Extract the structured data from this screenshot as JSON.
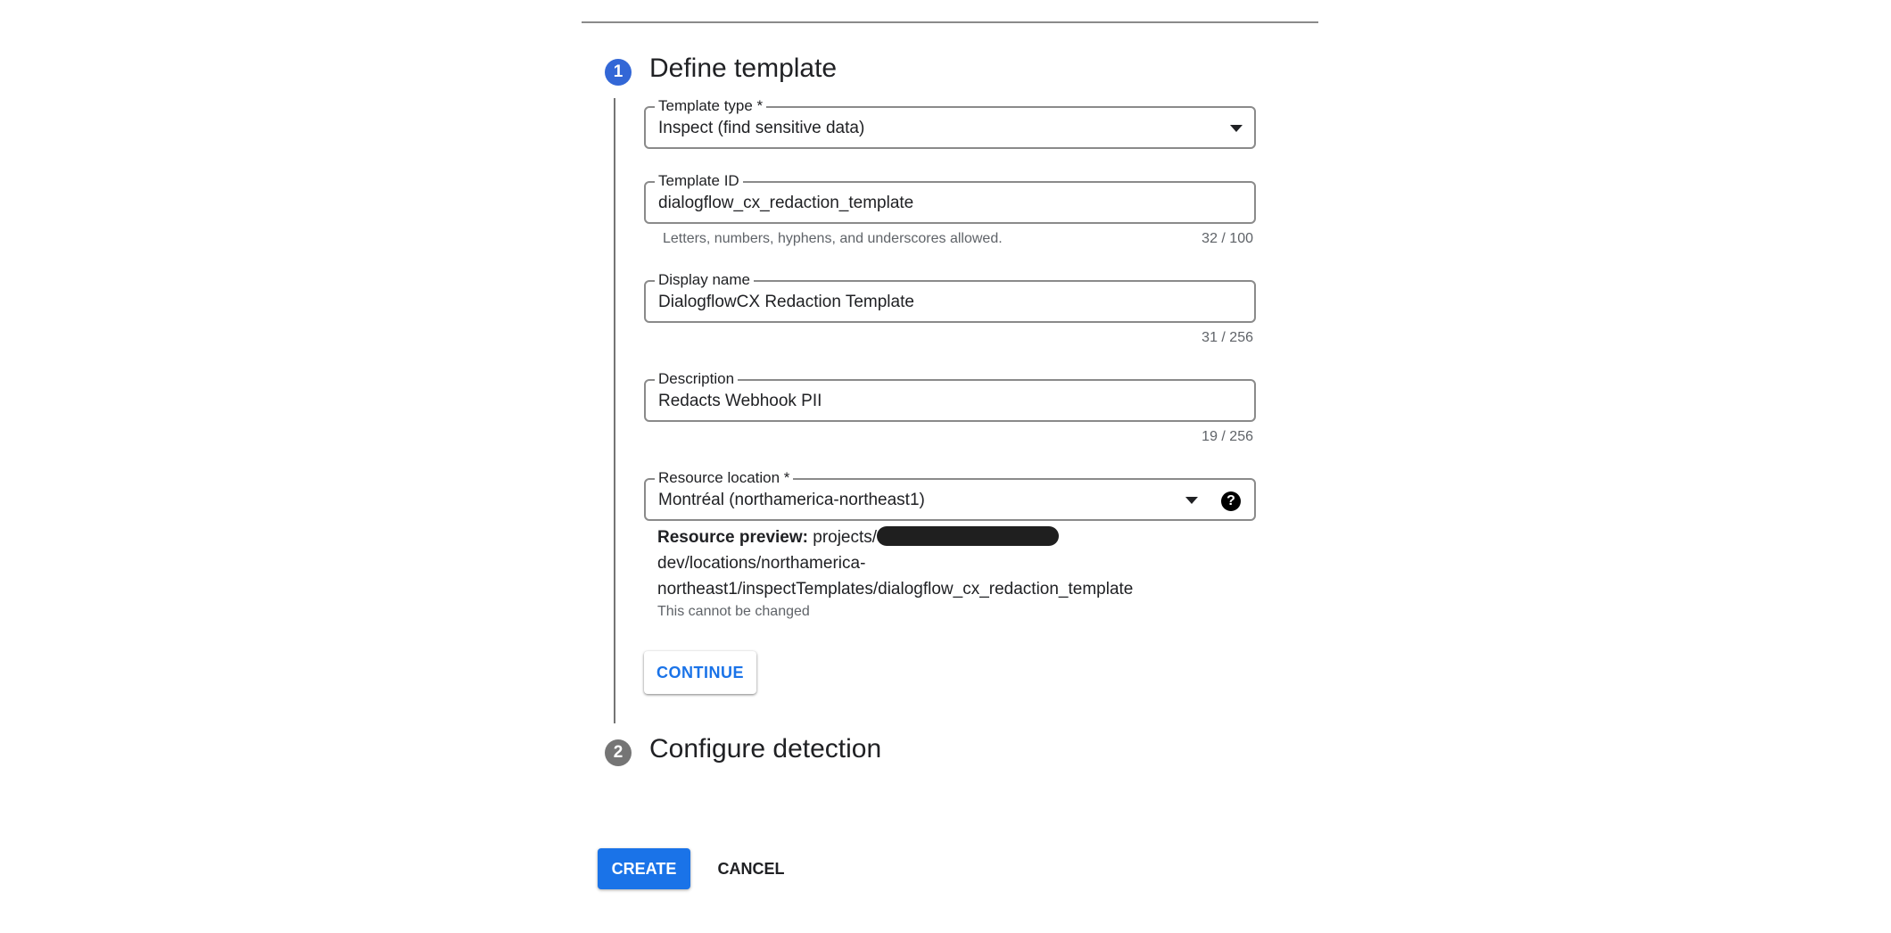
{
  "steps": [
    {
      "number": "1",
      "title": "Define template",
      "active": true
    },
    {
      "number": "2",
      "title": "Configure detection",
      "active": false
    }
  ],
  "colors": {
    "active_step": "#3367d6",
    "inactive_step": "#757575",
    "primary": "#1a73e8"
  },
  "form": {
    "template_type": {
      "label": "Template type *",
      "value": "Inspect (find sensitive data)",
      "icon": "chevron-down-icon"
    },
    "template_id": {
      "label": "Template ID",
      "value": "dialogflow_cx_redaction_template",
      "hint": "Letters, numbers, hyphens, and underscores allowed.",
      "counter": "32 / 100"
    },
    "display_name": {
      "label": "Display name",
      "value": "DialogflowCX Redaction Template",
      "counter": "31 / 256"
    },
    "description": {
      "label": "Description",
      "value": "Redacts Webhook PII",
      "counter": "19 / 256"
    },
    "resource_location": {
      "label": "Resource location *",
      "value": "Montréal (northamerica-northeast1)",
      "icon": "chevron-down-icon",
      "help_icon": "help-icon",
      "help_glyph": "?"
    }
  },
  "resource_preview": {
    "label": "Resource preview:",
    "line1": "projects/",
    "line2": "dev/locations/northamerica-",
    "line3": "northeast1/inspectTemplates/dialogflow_cx_redaction_template",
    "note": "This cannot be changed"
  },
  "buttons": {
    "continue": "CONTINUE",
    "create": "CREATE",
    "cancel": "CANCEL"
  }
}
